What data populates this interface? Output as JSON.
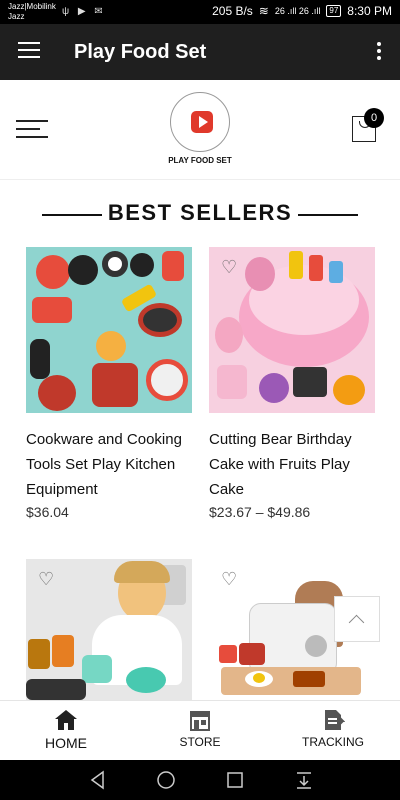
{
  "status_bar": {
    "carrier_line1": "Jazz|Mobilink",
    "carrier_line2": "Jazz",
    "speed": "205 B/s",
    "signal": "26 .ıll 26 .ıll",
    "battery": "97",
    "time": "8:30 PM"
  },
  "app_bar": {
    "title": "Play Food Set"
  },
  "header": {
    "logo_text": "PLAY FOOD SET",
    "cart_count": "0"
  },
  "section": {
    "title": "BEST SELLERS"
  },
  "products": [
    {
      "name": "Cookware and Cooking Tools Set Play Kitchen Equipment",
      "price": "$36.04"
    },
    {
      "name": "Cutting Bear Birthday Cake with Fruits Play Cake",
      "price": "$23.67 – $49.86"
    },
    {
      "name": "",
      "price": ""
    },
    {
      "name": "",
      "price": ""
    }
  ],
  "bottom_nav": [
    {
      "label": "HOME"
    },
    {
      "label": "STORE"
    },
    {
      "label": "TRACKING"
    }
  ],
  "icons": {
    "menu": "hamburger-icon",
    "more": "kebab-icon",
    "cart": "shopping-bag-icon",
    "wishlist": "heart-icon",
    "home": "home-icon",
    "store": "store-icon",
    "tracking": "document-icon"
  },
  "colors": {
    "app_bar": "#1f1f1f",
    "logo_accent": "#e0392b"
  }
}
